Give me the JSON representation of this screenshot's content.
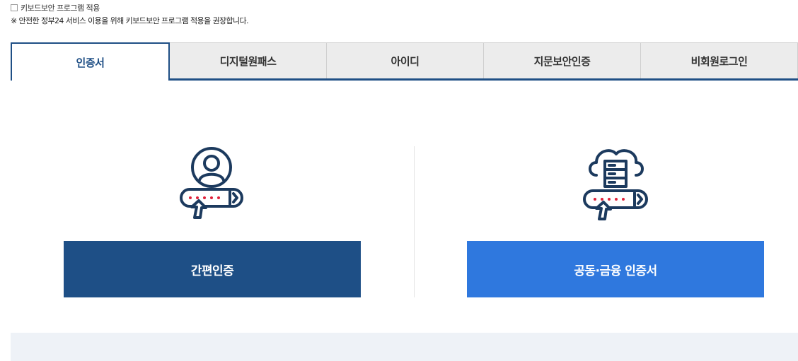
{
  "keyboard": {
    "checkbox_label": "키보드보안 프로그램 적용",
    "note": "※ 안전한 정부24 서비스 이용을 위해 키보드보안 프로그램 적용을 권장합니다."
  },
  "tabs": [
    {
      "label": "인증서",
      "active": true
    },
    {
      "label": "디지털원패스",
      "active": false
    },
    {
      "label": "아이디",
      "active": false
    },
    {
      "label": "지문보안인증",
      "active": false
    },
    {
      "label": "비회원로그인",
      "active": false
    }
  ],
  "options": {
    "simple": {
      "label": "간편인증",
      "icon": "user-login-icon",
      "color": "#1e4f86"
    },
    "cert": {
      "label": "공동·금융 인증서",
      "icon": "cloud-server-login-icon",
      "color": "#2f78de"
    }
  },
  "colors": {
    "accent": "#1f4f85",
    "icon_dots": "#e0213a"
  }
}
